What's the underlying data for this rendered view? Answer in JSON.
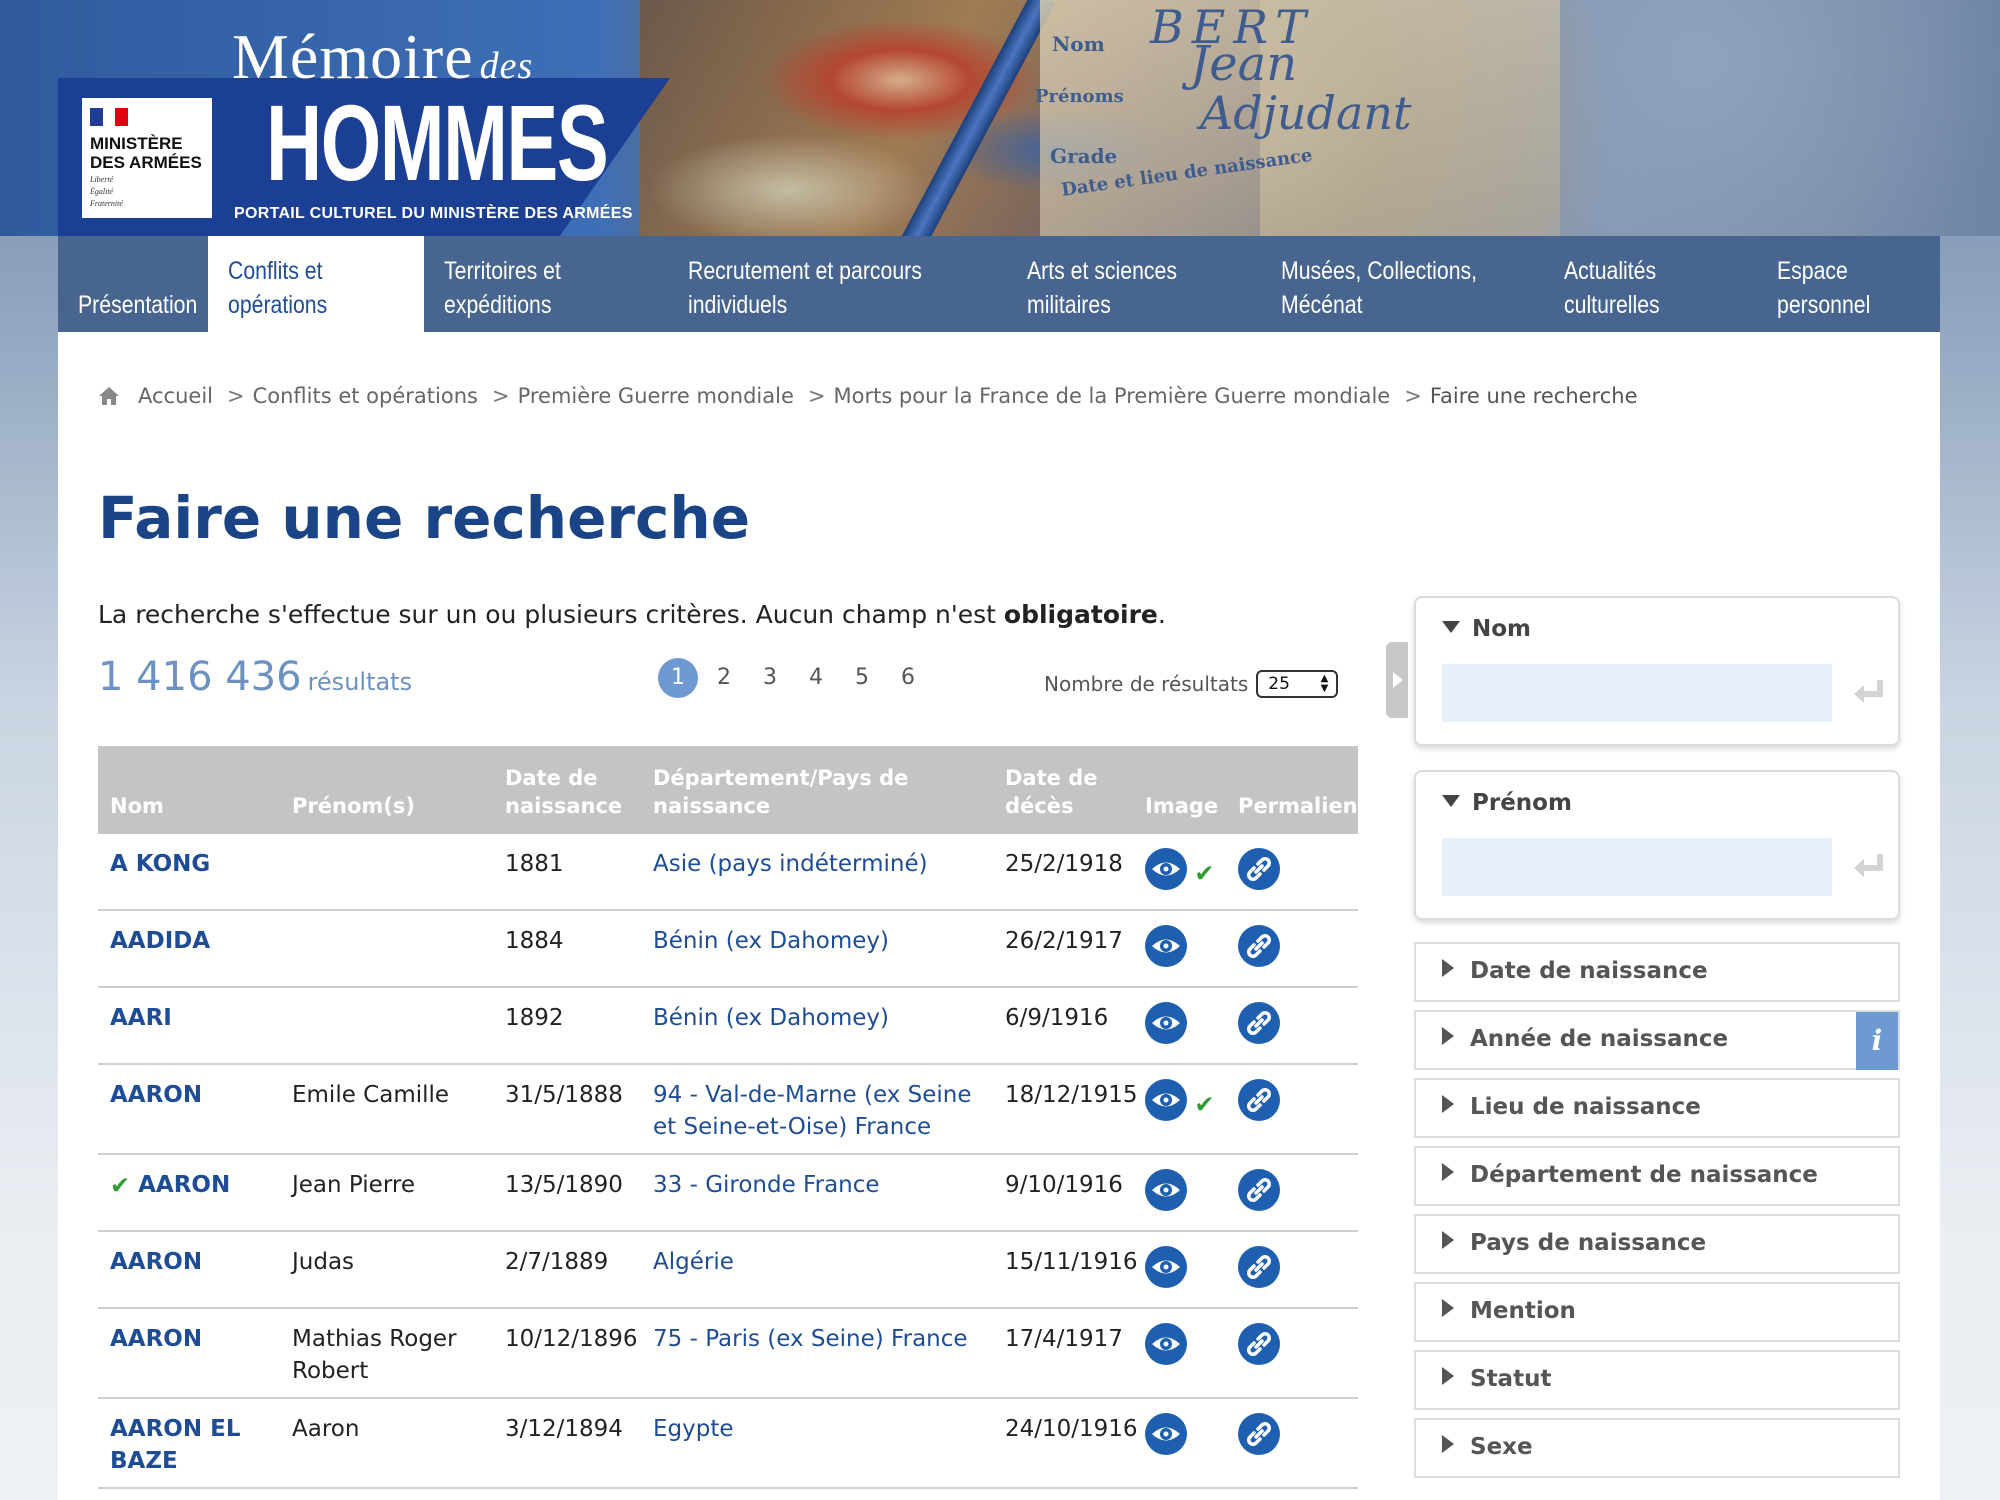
{
  "header": {
    "ministry_logo_lines": [
      "MINISTÈRE",
      "DES ARMÉES"
    ],
    "ministry_motto": [
      "Liberté",
      "Égalité",
      "Fraternité"
    ],
    "site_title_small": "Mémoire",
    "site_title_des": "des",
    "site_title_big": "HOMMES",
    "site_subtitle": "PORTAIL CULTUREL DU MINISTÈRE DES ARMÉES",
    "banner_doc_words": [
      "BERT",
      "Jean",
      "Adjudant",
      "Nom",
      "Prénoms",
      "Grade",
      "Date et lieu de naissance"
    ]
  },
  "nav": {
    "items": [
      {
        "line1": "Présentation",
        "line2": ""
      },
      {
        "line1": "Conflits et",
        "line2": "opérations",
        "active": true
      },
      {
        "line1": "Territoires et",
        "line2": "expéditions"
      },
      {
        "line1": "Recrutement et parcours",
        "line2": "individuels"
      },
      {
        "line1": "Arts et sciences",
        "line2": "militaires"
      },
      {
        "line1": "Musées, Collections,",
        "line2": "Mécénat"
      },
      {
        "line1": "Actualités",
        "line2": "culturelles"
      },
      {
        "line1": "Espace",
        "line2": "personnel"
      }
    ]
  },
  "breadcrumb": {
    "items": [
      "Accueil",
      "Conflits et opérations",
      "Première Guerre mondiale",
      "Morts pour la France de la Première Guerre mondiale",
      "Faire une recherche"
    ],
    "separator": ">"
  },
  "page": {
    "title": "Faire une recherche",
    "intro_prefix": "La recherche s'effectue sur un ou plusieurs critères. Aucun champ n'est ",
    "intro_bold": "obligatoire",
    "intro_suffix": ".",
    "results_count": "1 416 436",
    "results_label": "résultats",
    "pages": [
      "1",
      "2",
      "3",
      "4",
      "5",
      "6"
    ],
    "current_page": "1",
    "per_page_label": "Nombre de résultats",
    "per_page_value": "25"
  },
  "table": {
    "headers": {
      "nom": "Nom",
      "prenom": "Prénom(s)",
      "naissance_line1": "Date de",
      "naissance_line2": "naissance",
      "dept_line1": "Département/Pays de",
      "dept_line2": "naissance",
      "deces_line1": "Date de",
      "deces_line2": "décès",
      "image": "Image",
      "permalien": "Permalien"
    },
    "rows": [
      {
        "nom": "A KONG",
        "prenom": "",
        "naissance": "1881",
        "dept": "Asie (pays indéterminé)",
        "deces": "25/2/1918",
        "image_checked": true,
        "name_checked": false
      },
      {
        "nom": "AADIDA",
        "prenom": "",
        "naissance": "1884",
        "dept": "Bénin (ex Dahomey)",
        "deces": "26/2/1917",
        "image_checked": false,
        "name_checked": false
      },
      {
        "nom": "AARI",
        "prenom": "",
        "naissance": "1892",
        "dept": "Bénin (ex Dahomey)",
        "deces": "6/9/1916",
        "image_checked": false,
        "name_checked": false
      },
      {
        "nom": "AARON",
        "prenom": "Emile Camille",
        "naissance": "31/5/1888",
        "dept": "94 - Val-de-Marne (ex Seine et Seine-et-Oise) France",
        "deces": "18/12/1915",
        "image_checked": true,
        "name_checked": false
      },
      {
        "nom": "AARON",
        "prenom": "Jean Pierre",
        "naissance": "13/5/1890",
        "dept": "33 - Gironde France",
        "deces": "9/10/1916",
        "image_checked": false,
        "name_checked": true
      },
      {
        "nom": "AARON",
        "prenom": "Judas",
        "naissance": "2/7/1889",
        "dept": "Algérie",
        "deces": "15/11/1916",
        "image_checked": false,
        "name_checked": false
      },
      {
        "nom": "AARON",
        "prenom": "Mathias Roger Robert",
        "naissance": "10/12/1896",
        "dept": "75 - Paris (ex Seine) France",
        "deces": "17/4/1917",
        "image_checked": false,
        "name_checked": false
      },
      {
        "nom": "AARON EL BAZE",
        "prenom": "Aaron",
        "naissance": "3/12/1894",
        "dept": "Egypte",
        "deces": "24/10/1916",
        "image_checked": false,
        "name_checked": false
      }
    ]
  },
  "sidebar": {
    "nom_title": "Nom",
    "prenom_title": "Prénom",
    "info_glyph": "i",
    "facets": [
      "Date de naissance",
      "Année de naissance",
      "Lieu de naissance",
      "Département de naissance",
      "Pays de naissance",
      "Mention",
      "Statut",
      "Sexe"
    ]
  },
  "colors": {
    "title_blue": "#1a4485",
    "link_blue": "#1e4d96",
    "nav_bg": "#47658f",
    "table_header_bg": "#c4c4c4",
    "accent_light_blue": "#6d9bd1",
    "check_green": "#2f9e2f"
  },
  "icons": {
    "home": "home-icon",
    "image": "eye-icon",
    "permalink": "link-icon",
    "checked": "check-icon",
    "return": "return-icon",
    "info": "info-icon",
    "sidebar_toggle": "sidebar-toggle-icon"
  }
}
